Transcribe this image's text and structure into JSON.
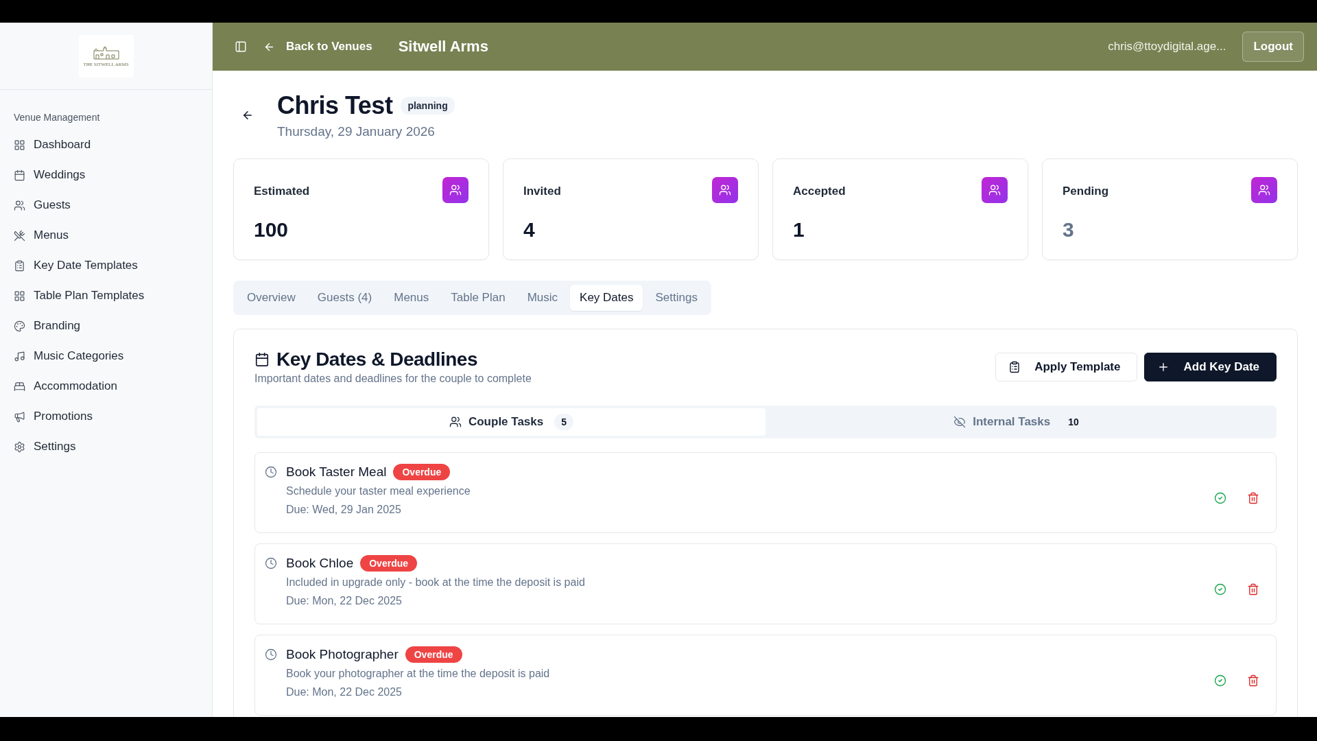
{
  "sidebar": {
    "logo_text": "THE SITWELL ARMS",
    "section": "Venue Management",
    "items": [
      {
        "label": "Dashboard",
        "selected": false
      },
      {
        "label": "Weddings",
        "selected": false
      },
      {
        "label": "Guests",
        "selected": false
      },
      {
        "label": "Menus",
        "selected": false
      },
      {
        "label": "Key Date Templates",
        "selected": false
      },
      {
        "label": "Table Plan Templates",
        "selected": false
      },
      {
        "label": "Branding",
        "selected": false
      },
      {
        "label": "Music Categories",
        "selected": false
      },
      {
        "label": "Accommodation",
        "selected": false
      },
      {
        "label": "Promotions",
        "selected": false
      },
      {
        "label": "Settings",
        "selected": false
      }
    ]
  },
  "header": {
    "back_label": "Back to Venues",
    "venue": "Sitwell Arms",
    "user": "chris@ttoydigital.age...",
    "logout": "Logout"
  },
  "wedding": {
    "name": "Chris Test",
    "status": "planning",
    "date": "Thursday, 29 January 2026"
  },
  "stats": [
    {
      "label": "Estimated",
      "value": "100",
      "color": "#0f172a"
    },
    {
      "label": "Invited",
      "value": "4",
      "color": "#0f172a"
    },
    {
      "label": "Accepted",
      "value": "1",
      "color": "#0f172a"
    },
    {
      "label": "Pending",
      "value": "3",
      "color": "#64748b"
    }
  ],
  "tabs": [
    {
      "label": "Overview",
      "selected": false
    },
    {
      "label": "Guests (4)",
      "selected": false
    },
    {
      "label": "Menus",
      "selected": false
    },
    {
      "label": "Table Plan",
      "selected": false
    },
    {
      "label": "Music",
      "selected": false
    },
    {
      "label": "Key Dates",
      "selected": true
    },
    {
      "label": "Settings",
      "selected": false
    }
  ],
  "key_dates": {
    "title": "Key Dates & Deadlines",
    "subtitle": "Important dates and deadlines for the couple to complete",
    "buttons": [
      {
        "label": "Apply Template",
        "kind": "outline"
      },
      {
        "label": "Add Key Date",
        "kind": "primary"
      }
    ],
    "task_tabs": [
      {
        "label": "Couple Tasks",
        "count": "5",
        "selected": true,
        "kind": "couple"
      },
      {
        "label": "Internal Tasks",
        "count": "10",
        "selected": false,
        "kind": "internal"
      }
    ],
    "tasks": [
      {
        "title": "Book Taster Meal",
        "badge": "Overdue",
        "description": "Schedule your taster meal experience",
        "due": "Due: Wed, 29 Jan 2025"
      },
      {
        "title": "Book Chloe",
        "badge": "Overdue",
        "description": "Included in upgrade only - book at the time the deposit is paid",
        "due": "Due: Mon, 22 Dec 2025"
      },
      {
        "title": "Book Photographer",
        "badge": "Overdue",
        "description": "Book your photographer at the time the deposit is paid",
        "due": "Due: Mon, 22 Dec 2025"
      }
    ]
  }
}
